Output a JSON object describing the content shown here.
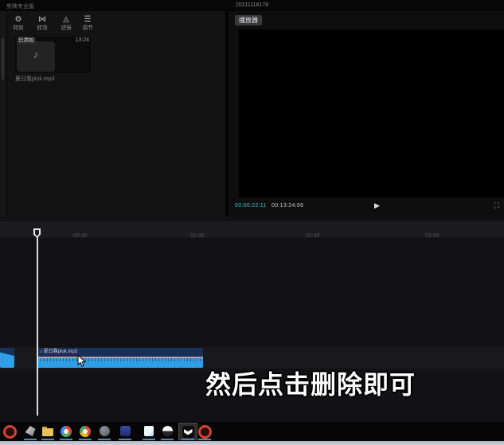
{
  "titlebar": {
    "app_title": "剪映专业版",
    "doc_title": "20211118178"
  },
  "library": {
    "tabs": [
      {
        "id": "effects",
        "label": "特效"
      },
      {
        "id": "transitions",
        "label": "转场"
      },
      {
        "id": "filters",
        "label": "滤镜"
      },
      {
        "id": "adjust",
        "label": "调节"
      }
    ],
    "media": {
      "badge": "已添加",
      "duration": "13:24",
      "filename": "夏日靠pluk.mp3"
    }
  },
  "preview": {
    "header": "播放器",
    "current_time": "00:00:22:11",
    "total_time": "00:13:24:06"
  },
  "timeline": {
    "ticks": [
      "00:30",
      "01:00",
      "01:30",
      "02:00"
    ],
    "clip": {
      "label": "夏日靠pluk.mp3"
    }
  },
  "subtitle": {
    "text": "然后点击删除即可"
  },
  "icons": {
    "effects": "⚙",
    "transitions": "⋈",
    "filters": "◬",
    "adjust": "☰",
    "music_note": "♪",
    "play": "▶",
    "fullscreen": "⛶"
  },
  "taskbar": {
    "icons": [
      "recorder-icon",
      "explorer-app-icon",
      "folder-icon",
      "browser-multicolor-icon",
      "browser-warm-icon",
      "gray-app-icon",
      "blue-app-icon",
      "notes-app-icon",
      "music-app-icon",
      "jianying-app-icon",
      "recorder-icon-2"
    ]
  },
  "colors": {
    "clip_blue": "#2f9ee4",
    "clip_header_navy": "#16305a",
    "timecode_teal": "#48bcc2",
    "taskbar_indicator": "#4d87b8",
    "subtitle_white": "#ffffff"
  }
}
